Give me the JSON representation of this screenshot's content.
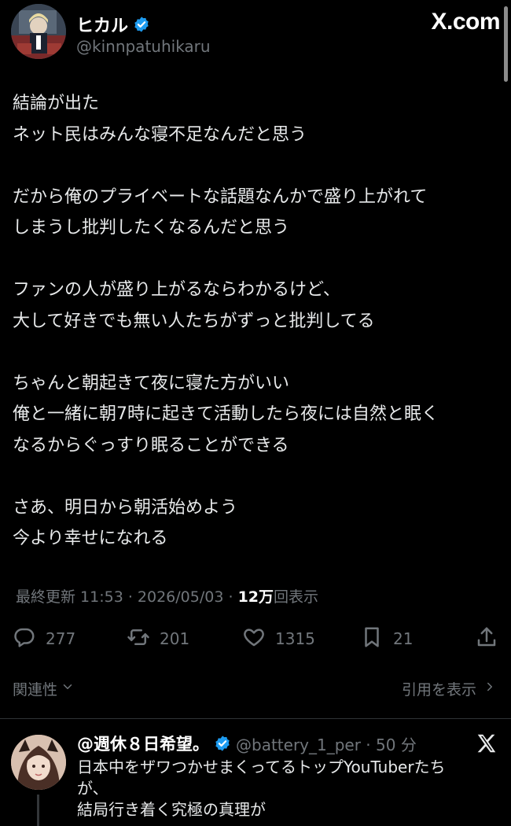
{
  "author": {
    "display_name": "ヒカル",
    "handle": "@kinnpatuhikaru",
    "verified": true
  },
  "brand": "X.com",
  "tweet": {
    "lines": [
      "結論が出た",
      "ネット民はみんな寝不足なんだと思う",
      "",
      "だから俺のプライベートな話題なんかで盛り上がれて",
      "しまうし批判したくなるんだと思う",
      "",
      "ファンの人が盛り上がるならわかるけど、",
      "大して好きでも無い人たちがずっと批判してる",
      "",
      "ちゃんと朝起きて夜に寝た方がいい",
      "俺と一緒に朝7時に起きて活動したら夜には自然と眠く",
      "なるからぐっすり眠ることができる",
      "",
      "さあ、明日から朝活始めよう",
      "今より幸せになれる"
    ]
  },
  "meta": {
    "updated_label": "最終更新 11:53 · 2026/05/03",
    "separator": " · ",
    "views_count": "12万",
    "views_label": "回表示"
  },
  "actions": {
    "replies": "277",
    "reposts": "201",
    "likes": "1315",
    "bookmarks": "21"
  },
  "related": {
    "left_label": "関連性",
    "right_label": "引用を表示"
  },
  "reply": {
    "name": "@週休８日希望。",
    "handle_time": "@battery_1_per · 50 分",
    "lines": [
      "日本中をザワつかせまくってるトップYouTuberたち",
      "が、",
      "結局行き着く究極の真理が"
    ]
  },
  "colors": {
    "background": "#000000",
    "text": "#e7e9ea",
    "muted": "#71767b",
    "verified": "#1d9bf0"
  },
  "icons": {
    "verified": "verified-badge-icon",
    "reply": "comment-icon",
    "repost": "repost-icon",
    "like": "heart-icon",
    "bookmark": "bookmark-icon",
    "share": "share-icon",
    "chevron_down": "chevron-down-icon",
    "chevron_right": "chevron-right-icon",
    "x_logo": "x-logo-icon"
  }
}
